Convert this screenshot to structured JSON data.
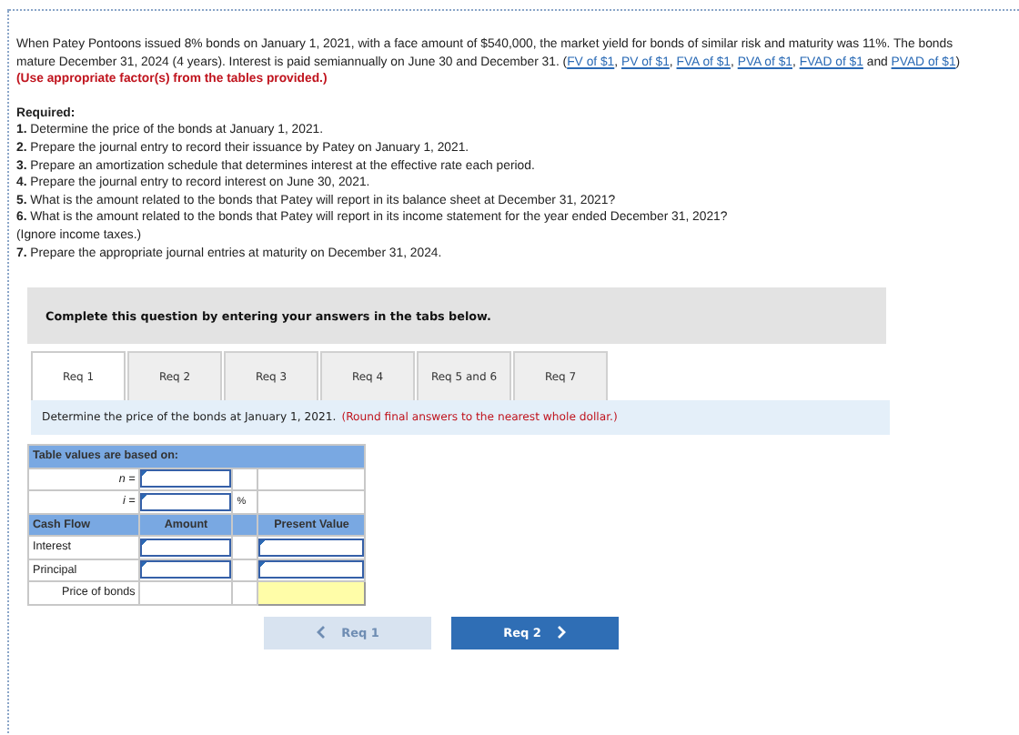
{
  "intro": [
    {
      "kind": "text",
      "text": "When Patey Pontoons issued 8% bonds on January 1, 2021, with a face amount of $540,000, the market yield for bonds of similar risk and maturity was 11%. The bonds mature December 31, 2024 (4 years). Interest is paid semiannually on June 30 and December 31. ("
    },
    {
      "kind": "link",
      "text": "FV of $1"
    },
    {
      "kind": "text",
      "text": ", "
    },
    {
      "kind": "link",
      "text": "PV of $1"
    },
    {
      "kind": "text",
      "text": ", "
    },
    {
      "kind": "link",
      "text": "FVA of $1"
    },
    {
      "kind": "text",
      "text": ", "
    },
    {
      "kind": "link",
      "text": "PVA of $1"
    },
    {
      "kind": "text",
      "text": ", "
    },
    {
      "kind": "link",
      "text": "FVAD of $1"
    },
    {
      "kind": "text",
      "text": " and "
    },
    {
      "kind": "link",
      "text": "PVAD of $1"
    },
    {
      "kind": "text",
      "text": ") "
    },
    {
      "kind": "emphasis",
      "text": "(Use appropriate factor(s) from the tables provided.)"
    }
  ],
  "required": {
    "heading": "Required:",
    "items": [
      "**1.** Determine the price of the bonds at January 1, 2021.",
      "**2.** Prepare the journal entry to record their issuance by Patey on January 1, 2021.",
      "**3.** Prepare an amortization schedule that determines interest at the effective rate each period.",
      "**4.** Prepare the journal entry to record interest on June 30, 2021.",
      "**5.** What is the amount related to the bonds that Patey will report in its balance sheet at December 31, 2021?",
      "**6.** What is the amount related to the bonds that Patey will report in its income statement for the year ended December 31, 2021?",
      "(Ignore income taxes.)",
      "**7.** Prepare the appropriate journal entries at maturity on December 31, 2024."
    ]
  },
  "banner": "Complete this question by entering your answers in the tabs below.",
  "tabs": [
    {
      "label": "Req 1",
      "selected": true
    },
    {
      "label": "Req 2",
      "selected": false
    },
    {
      "label": "Req 3",
      "selected": false
    },
    {
      "label": "Req 4",
      "selected": false
    },
    {
      "label": "Req 5 and 6",
      "selected": false
    },
    {
      "label": "Req 7",
      "selected": false
    }
  ],
  "prompt": {
    "text": "Determine the price of the bonds at January 1, 2021.",
    "note": "(Round final answers to the nearest whole dollar.)"
  },
  "table": {
    "caption": "Table values are based on:",
    "params": [
      {
        "label": "n ="
      },
      {
        "label": "i =",
        "unit": "%"
      }
    ],
    "columns": [
      "Cash Flow",
      "Amount",
      "Present Value"
    ],
    "rows": [
      {
        "label": "Interest",
        "kind": "input"
      },
      {
        "label": "Principal",
        "kind": "input"
      },
      {
        "label": "Price of bonds",
        "kind": "total"
      }
    ]
  },
  "nav": [
    {
      "label": "Req 1",
      "kind": "prev",
      "disabled": true
    },
    {
      "label": "Req 2",
      "kind": "next",
      "disabled": false
    }
  ]
}
